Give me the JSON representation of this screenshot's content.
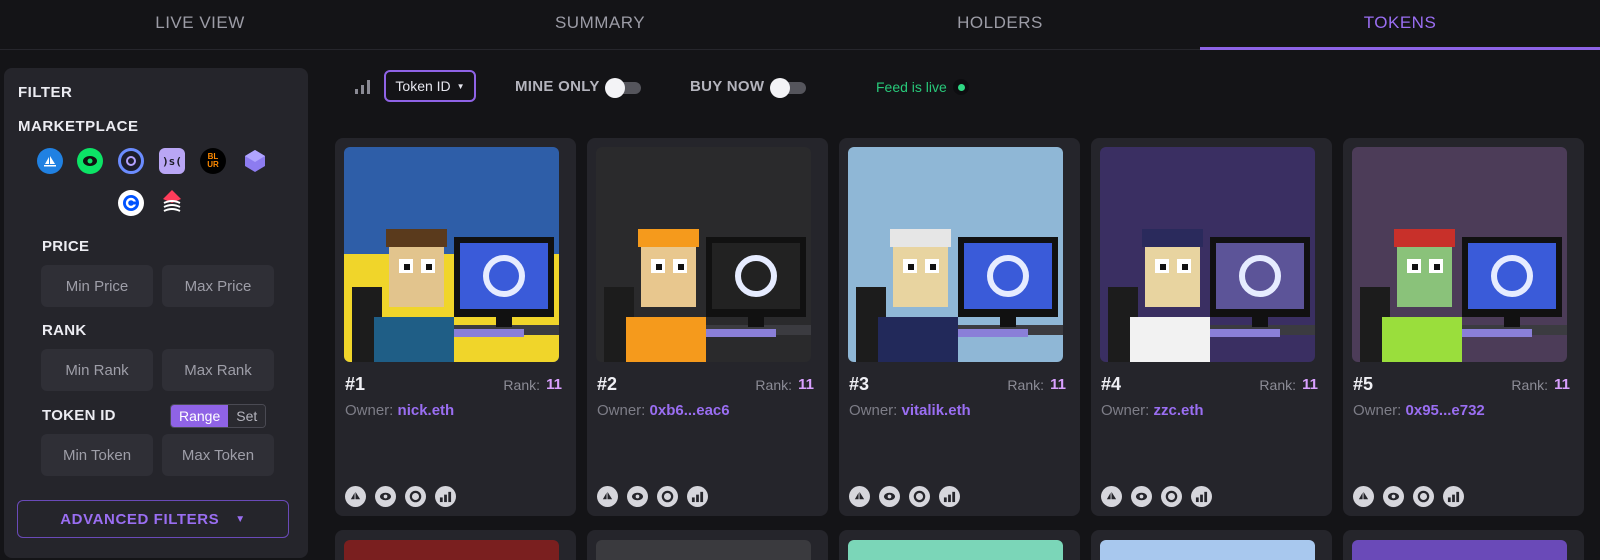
{
  "tabs": [
    {
      "label": "LIVE VIEW",
      "active": false
    },
    {
      "label": "SUMMARY",
      "active": false
    },
    {
      "label": "HOLDERS",
      "active": false
    },
    {
      "label": "TOKENS",
      "active": true
    }
  ],
  "sidebar": {
    "title": "FILTER",
    "marketplace_title": "MARKETPLACE",
    "marketplaces": [
      {
        "icon": "opensea-icon",
        "color": "#2081e2"
      },
      {
        "icon": "looksrare-icon",
        "color": "#0ce466"
      },
      {
        "icon": "x2y2-icon",
        "color": "#1d1d2c"
      },
      {
        "icon": "sudoswap-icon",
        "color": "#b9a6f5"
      },
      {
        "icon": "blur-icon",
        "color": "#000000"
      },
      {
        "icon": "nftx-icon",
        "color": "#8d7cf0"
      },
      {
        "icon": "coinbase-icon",
        "color": "#ffffff"
      },
      {
        "icon": "zora-icon",
        "color": "#ff3c5a"
      }
    ],
    "price_label": "PRICE",
    "min_price_placeholder": "Min Price",
    "max_price_placeholder": "Max Price",
    "rank_label": "RANK",
    "min_rank_placeholder": "Min Rank",
    "max_rank_placeholder": "Max Rank",
    "token_id_label": "TOKEN ID",
    "segment": {
      "range": "Range",
      "set": "Set",
      "selected": "Range"
    },
    "min_token_placeholder": "Min Token",
    "max_token_placeholder": "Max Token",
    "advanced_filters": "ADVANCED FILTERS"
  },
  "toolbar": {
    "sort_icon": "bar-chart-icon",
    "sort_value": "Token ID",
    "mine_only_label": "MINE ONLY",
    "mine_only_on": false,
    "buy_now_label": "BUY NOW",
    "buy_now_on": false,
    "feed_status": "Feed is live"
  },
  "cards": [
    {
      "number": "#1",
      "rank_label": "Rank:",
      "rank": "11",
      "owner_label": "Owner:",
      "owner": "nick.eth",
      "bg": "#2e5ea8",
      "bg2": "#f0d52a",
      "hair": "#5a3a1c",
      "shirt": "#1f5e86",
      "skin": "#e2c48d",
      "screen": "#3a5bd9"
    },
    {
      "number": "#2",
      "rank_label": "Rank:",
      "rank": "11",
      "owner_label": "Owner:",
      "owner": "0xb6...eac6",
      "bg": "#2a2a2c",
      "bg2": "#2a2a2c",
      "hair": "#f59a1c",
      "shirt": "#f59a1c",
      "skin": "#e8c78e",
      "screen": "#222222"
    },
    {
      "number": "#3",
      "rank_label": "Rank:",
      "rank": "11",
      "owner_label": "Owner:",
      "owner": "vitalik.eth",
      "bg": "#8fb7d6",
      "bg2": "#8fb7d6",
      "hair": "#e6e6e6",
      "shirt": "#22295a",
      "skin": "#e8d4a0",
      "screen": "#3a5bd9"
    },
    {
      "number": "#4",
      "rank_label": "Rank:",
      "rank": "11",
      "owner_label": "Owner:",
      "owner": "zzc.eth",
      "bg": "#3a2f62",
      "bg2": "#3a2f62",
      "hair": "#2a2a5c",
      "shirt": "#f2f2f2",
      "skin": "#e8d4a0",
      "screen": "#5c5498"
    },
    {
      "number": "#5",
      "rank_label": "Rank:",
      "rank": "11",
      "owner_label": "Owner:",
      "owner": "0x95...e732",
      "bg": "#4c3c58",
      "bg2": "#4c3c58",
      "hair": "#c8302a",
      "shirt": "#9ade3c",
      "skin": "#8ac27a",
      "screen": "#3a5bd9"
    }
  ],
  "card_marketplace_icons": [
    "opensea-icon",
    "looksrare-icon",
    "x2y2-icon",
    "chart-icon"
  ],
  "peek_colors": [
    "#7a1f1f",
    "#3a3a3e",
    "#7bd6b8",
    "#a8c8ee",
    "#6a4ab8"
  ]
}
